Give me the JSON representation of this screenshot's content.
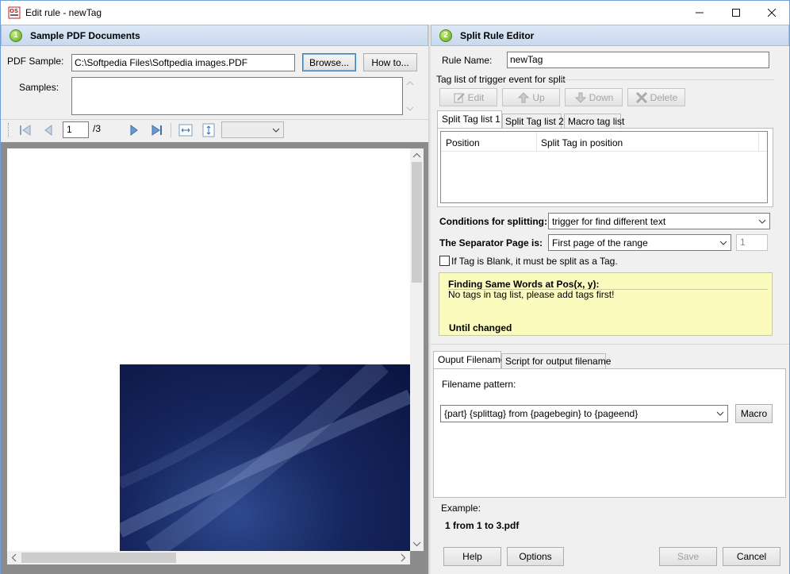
{
  "window": {
    "title": "Edit rule - newTag",
    "icon": "app-logo-icon",
    "controls": [
      "minimize-icon",
      "maximize-icon",
      "close-icon"
    ]
  },
  "left_panel": {
    "step": "1",
    "title": "Sample PDF Documents",
    "pdf_sample_label": "PDF Sample:",
    "pdf_sample_value": "C:\\Softpedia Files\\Softpedia images.PDF",
    "browse_label": "Browse...",
    "howto_label": "How to...",
    "samples_label": "Samples:",
    "page_current": "1",
    "page_total": "/3",
    "zoom_value": ""
  },
  "right_panel": {
    "step": "2",
    "title": "Split Rule Editor",
    "rule_name_label": "Rule Name:",
    "rule_name_value": "newTag",
    "tag_list_group": "Tag list of trigger event for split",
    "edit_label": "Edit",
    "up_label": "Up",
    "down_label": "Down",
    "delete_label": "Delete",
    "tabs": [
      "Split Tag list 1",
      "Split Tag list 2",
      "Macro tag list"
    ],
    "columns": [
      "Position",
      "Split Tag in position"
    ],
    "conditions_label": "Conditions for splitting:",
    "conditions_value": "trigger for find different text",
    "separator_label": "The Separator Page is:",
    "separator_value": "First page of the range",
    "separator_number": "1",
    "blank_checkbox_label": "If Tag is Blank, it must be split as a Tag.",
    "blank_checked": false,
    "info_title": "Finding Same Words at Pos(x, y):",
    "info_message": "No tags in tag list, please add tags first!",
    "info_footer": "Until changed",
    "output_tabs": [
      "Ouput Filename",
      "Script for output filename"
    ],
    "filename_pattern_label": "Filename pattern:",
    "filename_pattern_value": "{part} {splittag} from {pagebegin} to {pageend}",
    "macro_label": "Macro",
    "example_label": "Example:",
    "example_value": "1  from 1 to 3.pdf"
  },
  "footer": {
    "help_label": "Help",
    "options_label": "Options",
    "save_label": "Save",
    "cancel_label": "Cancel"
  },
  "colors": {
    "accent_border": "#6f9fd8",
    "header_bg": "#c9d9ef",
    "info_bg": "#fbfbbe",
    "pdf_image_dark": "#0f1a4a"
  }
}
